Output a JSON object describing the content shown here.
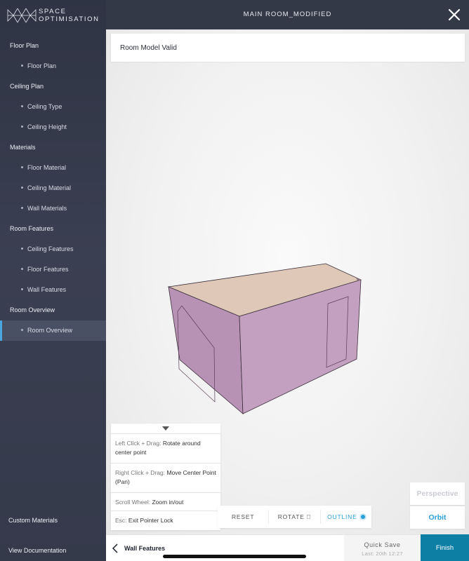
{
  "brand": {
    "line1": "SPACE",
    "line2": "OPTIMISATION"
  },
  "header": {
    "title": "MAIN ROOM_MODIFIED"
  },
  "sidebar": {
    "sections": [
      {
        "label": "Floor Plan",
        "items": [
          {
            "label": "Floor Plan"
          }
        ]
      },
      {
        "label": "Ceiling Plan",
        "items": [
          {
            "label": "Ceiling Type"
          },
          {
            "label": "Ceiling Height"
          }
        ]
      },
      {
        "label": "Materials",
        "items": [
          {
            "label": "Floor Material"
          },
          {
            "label": "Ceiling Material"
          },
          {
            "label": "Wall Materials"
          }
        ]
      },
      {
        "label": "Room Features",
        "items": [
          {
            "label": "Ceiling Features"
          },
          {
            "label": "Floor Features"
          },
          {
            "label": "Wall Features"
          }
        ]
      },
      {
        "label": "Room Overview",
        "items": [
          {
            "label": "Room Overview"
          }
        ]
      }
    ],
    "active_item": "Room Overview",
    "custom_materials": "Custom Materials",
    "view_documentation": "View Documentation"
  },
  "status": {
    "text": "Room Model Valid"
  },
  "help": {
    "rows": [
      {
        "key": "Left Click + Drag:",
        "value": "Rotate around center point"
      },
      {
        "key": "Right Click + Drag:",
        "value": "Move Center Point (Pan)"
      },
      {
        "key": "Scroll Wheel:",
        "value": "Zoom in/out"
      },
      {
        "key": "Esc:",
        "value": "Exit Pointer Lock"
      }
    ]
  },
  "toolbar": {
    "reset": "RESET",
    "rotate": "ROTATE ⃞",
    "outline": "OUTLINE"
  },
  "view_mode": {
    "perspective": "Perspective",
    "orbit": "Orbit"
  },
  "footer": {
    "back_label": "Wall Features",
    "quick_save": "Quick Save",
    "last_saved": "Last: 20th 12:27",
    "finish": "Finish"
  },
  "colors": {
    "accent": "#2aa0d8",
    "finish_bg": "#0d7fa5",
    "sidebar_bg": "#353a4b",
    "room_top": "#e0c8b9",
    "room_walls": "#c39fc0"
  }
}
